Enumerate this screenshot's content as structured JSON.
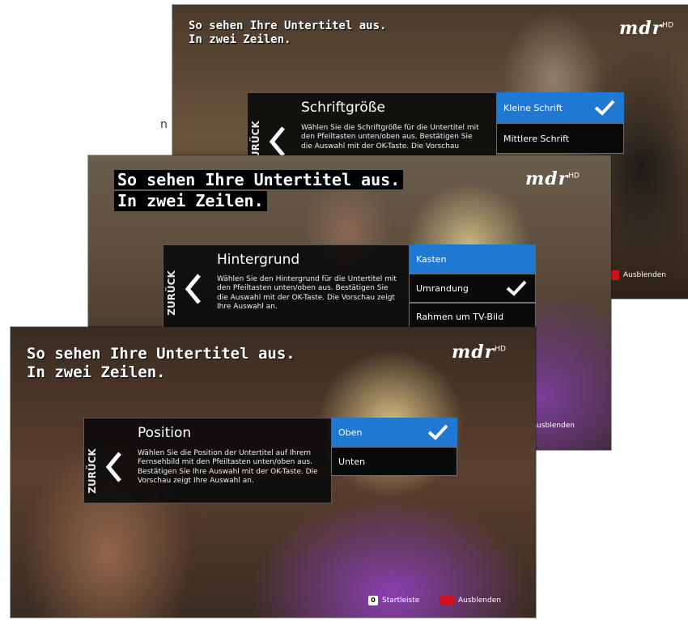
{
  "stray_text": "n",
  "shots": [
    {
      "subtitle": [
        "So sehen Ihre Untertitel aus.",
        "In zwei Zeilen."
      ],
      "logo": {
        "text": "mdr",
        "sup": "HD"
      },
      "back": "ZURÜCK",
      "title": "Schriftgröße",
      "description": "Wählen Sie die Schriftgröße für die Untertitel mit den Pfeiltasten unten/oben aus. Bestätigen Sie die Auswahl mit der OK-Taste. Die Vorschau",
      "options": [
        {
          "label": "Kleine Schrift",
          "selected": true,
          "checked": true
        },
        {
          "label": "Mittlere Schrift",
          "selected": false,
          "checked": false
        }
      ],
      "footer": {
        "hide": "Ausblenden"
      }
    },
    {
      "subtitle": [
        "So sehen Ihre Untertitel aus.",
        "In zwei Zeilen."
      ],
      "logo": {
        "text": "mdr",
        "sup": "HD"
      },
      "back": "ZURÜCK",
      "title": "Hintergrund",
      "description": "Wählen Sie den Hintergrund für die Untertitel mit den Pfeiltasten unten/oben aus. Bestätigen Sie die Auswahl mit der OK-Taste. Die Vorschau zeigt Ihre Auswahl an.",
      "options": [
        {
          "label": "Kasten",
          "selected": true,
          "checked": false
        },
        {
          "label": "Umrandung",
          "selected": false,
          "checked": true
        },
        {
          "label": "Rahmen um TV-Bild",
          "selected": false,
          "checked": false
        }
      ],
      "footer": {
        "hide": "Ausblenden"
      }
    },
    {
      "subtitle": [
        "So sehen Ihre Untertitel aus.",
        "In zwei Zeilen."
      ],
      "logo": {
        "text": "mdr",
        "sup": "HD"
      },
      "back": "ZURÜCK",
      "title": "Position",
      "description": "Wählen Sie die Position der Untertitel auf Ihrem Fernsehbild mit den Pfeiltasten unten/oben aus. Bestätigen Sie Ihre Auswahl mit der OK-Taste. Die Vorschau zeigt Ihre Auswahl an.",
      "options": [
        {
          "label": "Oben",
          "selected": true,
          "checked": true
        },
        {
          "label": "Unten",
          "selected": false,
          "checked": false
        }
      ],
      "footer": {
        "key": "0",
        "start": "Startleiste",
        "hide": "Ausblenden"
      }
    }
  ]
}
